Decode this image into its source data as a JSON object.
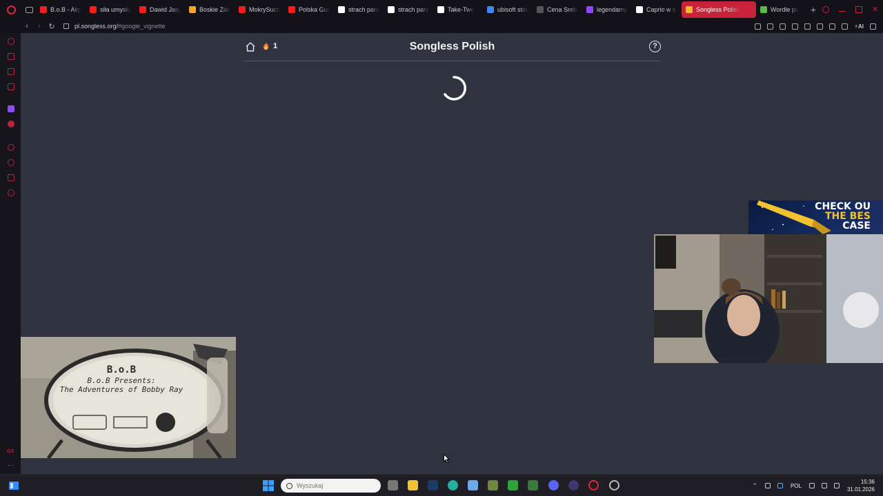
{
  "browser": {
    "tabs": [
      {
        "label": "B.o.B - Airp",
        "color": "#ff1a1a"
      },
      {
        "label": "siła umysłu",
        "color": "#ff1a1a"
      },
      {
        "label": "Dawid Jasp",
        "color": "#ff1a1a"
      },
      {
        "label": "Boskie Ziar",
        "color": "#f5a623"
      },
      {
        "label": "MokrySuch",
        "color": "#ff1a1a"
      },
      {
        "label": "Polska Gur",
        "color": "#ff1a1a"
      },
      {
        "label": "strach para",
        "color": "#ffffff"
      },
      {
        "label": "strach para",
        "color": "#ffffff"
      },
      {
        "label": "Take-Two",
        "color": "#ffffff"
      },
      {
        "label": "ubisoft stoc",
        "color": "#4285f4"
      },
      {
        "label": "Cena Srebr",
        "color": "#555555"
      },
      {
        "label": "legendarny",
        "color": "#9146ff"
      },
      {
        "label": "Caprio w sz",
        "color": "#ffffff"
      }
    ],
    "active_tab": {
      "label": "Songless Polish",
      "color": "#f2b632"
    },
    "extra_tab": {
      "label": "Wordle po",
      "color": "#59b84a"
    },
    "url_host": "pl.songless.org/",
    "url_path": "#google_vignette"
  },
  "game": {
    "title": "Songless Polish",
    "streak": "1",
    "help": "?"
  },
  "overlay": {
    "album_artist": "B.o.B",
    "album_title_1": "B.o.B Presents:",
    "album_title_2": "The Adventures of Bobby Ray",
    "promo_line1": "CHECK OU",
    "promo_line2": "THE BES",
    "promo_line3": "CASE"
  },
  "taskbar": {
    "search_placeholder": "Wyszukaj",
    "lang": "POL",
    "time": "15:36",
    "date": "31.01.2026"
  },
  "colors": {
    "accent": "#c8233a",
    "page_bg": "#2f323f"
  }
}
